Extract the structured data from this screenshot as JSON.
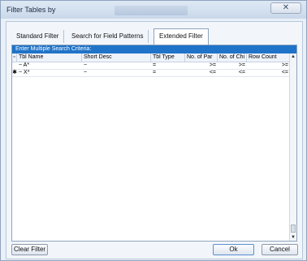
{
  "window": {
    "title": "Filter Tables by",
    "close_glyph": "✕"
  },
  "tabs": [
    {
      "label": "Standard Filter",
      "active": false
    },
    {
      "label": "Search for Field Patterns",
      "active": false
    },
    {
      "label": "Extended Filter",
      "active": true
    }
  ],
  "grid": {
    "section_title": "Enter Multiple Search Criteria:",
    "columns": [
      "Tbl Name",
      "Short Desc",
      "Tbl Type",
      "No. of Par",
      "No. of Chi",
      "Row Count"
    ],
    "rows": [
      {
        "indicator": "",
        "tbl_name": "~ A*",
        "short_desc": "~",
        "tbl_type": "=",
        "no_of_par": ">=",
        "no_of_chi": ">=",
        "row_count": ">="
      },
      {
        "indicator": "✱",
        "tbl_name": "~ X*",
        "short_desc": "~",
        "tbl_type": "=",
        "no_of_par": "<=",
        "no_of_chi": "<=",
        "row_count": "<="
      }
    ],
    "header_indicator": "▫"
  },
  "buttons": {
    "clear_filter": "Clear Filter",
    "ok": "Ok",
    "cancel": "Cancel"
  },
  "scrollbar": {
    "up_glyph": "▲",
    "down_glyph": "▼"
  }
}
